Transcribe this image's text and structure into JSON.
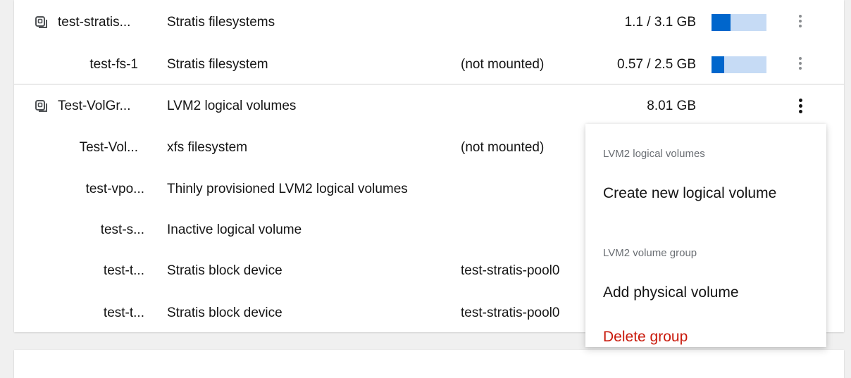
{
  "rows": [
    {
      "name": "test-stratis...",
      "type": "Stratis filesystems",
      "location": "",
      "size": "1.1 / 3.1 GB",
      "usage": 0.35
    },
    {
      "name": "test-fs-1",
      "type": "Stratis filesystem",
      "location": "(not mounted)",
      "size": "0.57 / 2.5 GB",
      "usage": 0.23
    },
    {
      "name": "Test-VolGr...",
      "type": "LVM2 logical volumes",
      "location": "",
      "size": "8.01 GB"
    },
    {
      "name": "Test-Vol...",
      "type": "xfs filesystem",
      "location": "(not mounted)"
    },
    {
      "name": "test-vpo...",
      "type": "Thinly provisioned LVM2 logical volumes"
    },
    {
      "name": "test-s...",
      "type": "Inactive logical volume"
    },
    {
      "name": "test-t...",
      "type": "Stratis block device",
      "location": "test-stratis-pool0"
    },
    {
      "name": "test-t...",
      "type": "Stratis block device",
      "location": "test-stratis-pool0"
    }
  ],
  "menu": {
    "group1": "LVM2 logical volumes",
    "create": "Create new logical volume",
    "group2": "LVM2 volume group",
    "add": "Add physical volume",
    "delete": "Delete group"
  },
  "colors": {
    "bar_fill": "#0066cc",
    "bar_track": "#c6dbf5",
    "danger": "#c9190b"
  },
  "icons": {
    "volume_group": "storage-icon",
    "actions": "kebab-icon"
  }
}
